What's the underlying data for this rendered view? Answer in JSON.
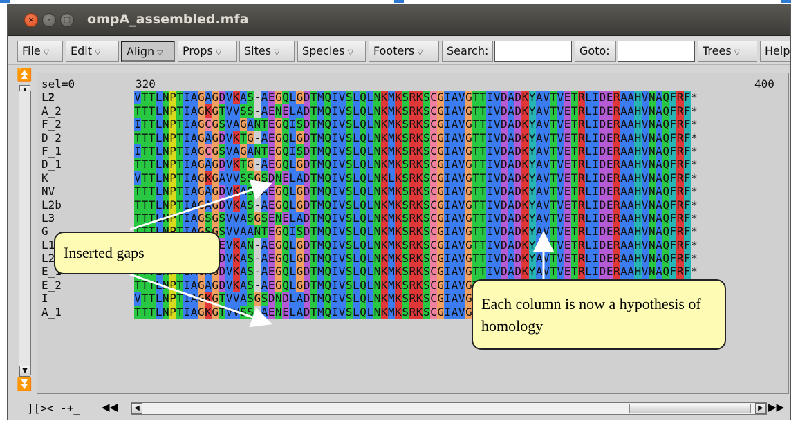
{
  "window": {
    "title": "ompA_assembled.mfa",
    "controls": {
      "close": "×",
      "minimize": "–",
      "maximize": "□"
    }
  },
  "toolbar": {
    "menus": [
      {
        "label": "File"
      },
      {
        "label": "Edit"
      },
      {
        "label": "Align"
      },
      {
        "label": "Props"
      },
      {
        "label": "Sites"
      },
      {
        "label": "Species"
      },
      {
        "label": "Footers"
      }
    ],
    "search_label": "Search:",
    "search_value": "",
    "goto_label": "Goto:",
    "goto_value": "",
    "trees_label": "Trees",
    "help_label": "Help",
    "dropdown_glyph": "▽"
  },
  "alignment": {
    "sel_label": "sel=0",
    "position_start": "320",
    "position_end": "400",
    "sequences": [
      {
        "name": "L2",
        "bold": true,
        "seq": "VTTLNPTIAGAGDVKAS-AEGQLGDTMQIVSLQLNKMKSRKSCGIAVGTTIVDADKYAVTVETRLIDERAAHVNAQFRF*"
      },
      {
        "name": "A_2",
        "seq": "TTTLNPTIAGKGTVVSS-AENELADTMQIVSLQLNKMKSRKSCGIAVGTTIVDADKYAVTVETRLIDERAAHVNAQFRF*"
      },
      {
        "name": "F_2",
        "seq": "ITTLNPTIAGCGSVAGANTEGQISDTMQIVSLQLNKMKSRKSCGIAVGTTIVDADKYAVTVETRLIDERAAHVNAQFRF*"
      },
      {
        "name": "D_2",
        "seq": "TTTLNPTIAGAGDVKTG-AEGQLGDTMQIVSLQLNKMKSRKSCGIAVGTTIVDADKYAVTVETRLIDERAAHVNAQFRF*"
      },
      {
        "name": "F_1",
        "seq": "ITTLNPTIAGCGSVAGANTEGQISDTMQIVSLQLNKMKSRKSCGIAVGTTIVDADKYAVTVETRLIDERAAHVNAQFRF*"
      },
      {
        "name": "D_1",
        "seq": "TTTLNPTIAGAGDVKTG-AEGQLGDTMQIVSLQLNKMKSRKSCGIAVGTTIVDADKYAVTVETRLIDERAAHVNAQFRF*"
      },
      {
        "name": "K",
        "seq": "VTTLNPTIAGKGAVVSSGSDNELADTMQIVSLQLNKLKSRKSCGIAVGTTIVDADKYAVTVETRLIDERAAHVNAQFRF*"
      },
      {
        "name": "NV",
        "seq": "TTTLNPTIAGAGDVKAS-AEGQLGDTMQIVSLQLNKMKSRKSCGIAVGTTIVDADKYAVTVETRLIDERAAHVNAQFRF*"
      },
      {
        "name": "L2b",
        "seq": "TTTLNPTIAGAGDVKAS-AEGQLGDTMQIVSLQLNKMKSRKSCGIAVGTTIVDADKYAVTVETRLIDERAAHVNAQFRF*"
      },
      {
        "name": "L3",
        "seq": "TTTLNPTIAGSGSVVASGSENELADTMQIVSLQLNKMKSRKSCGIAVGTTIVDADKYAVTVETRLIDERAAHVNAQFRF*"
      },
      {
        "name": "G",
        "seq": "TTTLNPTIAGSGSVVAANTEGQISDTMQIVSLQLNKMKSRKSCGIAVGTTIVDADKYAVTVETRLIDERAAHVNAQFRF*"
      },
      {
        "name": "L1",
        "seq": "TTTLNPTIAGAGEVKAN-AEGQLGDTMQIVSLQLNKMKSRKSCGIAVGTTIVDADKYAVTVETRLIDERAAHVNAQFRF*"
      },
      {
        "name": "L2_434_BU",
        "seq": "VTTLNPTIAGAGDVKAS-AEGQLGDTMQIVSLQLNKMKSRKSCGIAVGTTIVDADKYAVTVETRLIDERAAHVNAQFRF*"
      },
      {
        "name": "E_1",
        "seq": "TTTLNPTIAGAGDVKAS-AEGQLGDTMQIVSLQLNKMKSRKSCGIAVGTTIVDADKYAVTVETRLIDERAAHVNAQFRF*"
      },
      {
        "name": "E_2",
        "seq": "TTTLNPTIAGAGDVKAS-AEGQLGDTMQIVSLQLNKMKSRKSCGIAVGTTIVDADKYAVTVETRLIDERAAHVNAQFRF*"
      },
      {
        "name": "I",
        "seq": "VTTLNPTIAGKGTVVASGSDNDLADTMQIVSLQLNKMKSRKSCGIAVGTTIVDADKYAVTVETRLIDERAAHVNAQFRF*"
      },
      {
        "name": "A_1",
        "seq": "TTTLNPTIAGKGTVVSS-AENELADTMQIVSLQLNKMKSRKSCGIAVGTTIVDADKYAVTVETRLIDERAAHVNAQFRF*"
      }
    ]
  },
  "residue_colors": {
    "hydrophobic": "#3b7cf0",
    "polar_green": "#28c843",
    "acidic_magenta": "#b55bd6",
    "basic_red": "#e03838",
    "glycine_orange": "#f0a060",
    "proline_yellow": "#d8d81c",
    "cysteine_pink": "#f080a0",
    "aromatic_cyan": "#26b4b4",
    "gap": "#d0d0d0"
  },
  "bottom": {
    "nav_text": "][>< -+_",
    "rewind_glyph": "◀◀",
    "ffwd_glyph": "▶▶"
  },
  "annotations": {
    "inserted_gaps": "Inserted gaps",
    "column_hypothesis": "Each column is now a hypothesis of homology"
  }
}
